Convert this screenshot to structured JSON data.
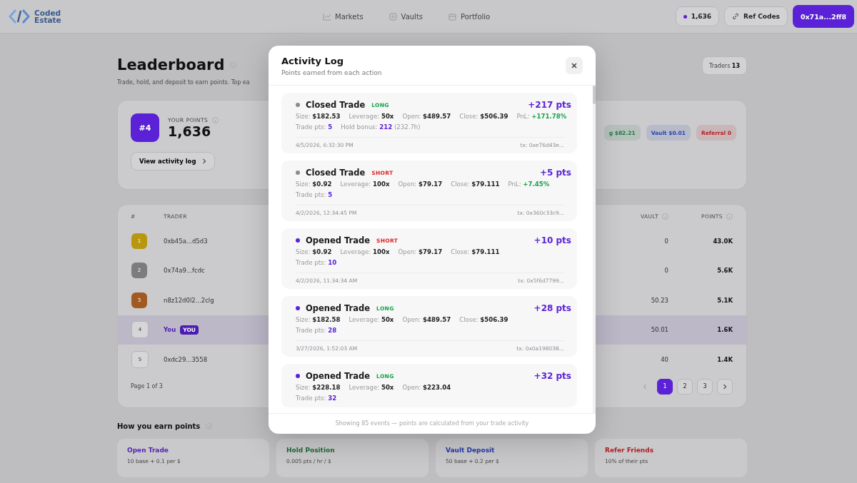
{
  "header": {
    "brand": [
      "Coded",
      "Estate"
    ],
    "nav": [
      {
        "label": "Markets"
      },
      {
        "label": "Vaults"
      },
      {
        "label": "Portfolio"
      }
    ],
    "points_pill": "1,636",
    "ref_button": "Ref Codes",
    "wallet_button": "0x71a...2ff8"
  },
  "leaderboard": {
    "title": "Leaderboard",
    "subtitle": "Trade, hold, and deposit to earn points. Top ea",
    "traders_label": "Traders",
    "traders_count": "13",
    "rank": "#4",
    "points_label": "YOUR POINTS",
    "points": "1,636",
    "activity_button": "View activity log",
    "badges": [
      {
        "text": "g $82.21",
        "color": "#1f7a40"
      },
      {
        "text": "Vault $0.01",
        "color": "#2a44b0"
      },
      {
        "text": "Referral 0",
        "color": "#b42323"
      }
    ],
    "columns": [
      "#",
      "TRADER",
      "VAULT",
      "POINTS"
    ],
    "rows": [
      {
        "rank": "1",
        "color": "#b8970f",
        "trader": "0xb45a...d5d3",
        "vault": "0",
        "points": "43.0K",
        "current": false
      },
      {
        "rank": "2",
        "color": "#7c7c7c",
        "trader": "0x74a9...fcdc",
        "vault": "0",
        "points": "5.6K",
        "current": false
      },
      {
        "rank": "3",
        "color": "#a15a22",
        "trader": "n8z12d0l2...2clg",
        "vault": "50.23",
        "points": "5.1K",
        "current": false
      },
      {
        "rank": "4",
        "trader": "You",
        "tag": "YOU",
        "vault": "50.01",
        "points": "1.6K",
        "current": true
      },
      {
        "rank": "5",
        "trader": "0xdc29...3558",
        "vault": "40",
        "points": "1.4K",
        "current": false
      }
    ],
    "page_info": "Page 1 of 3",
    "pages": [
      {
        "label": "1",
        "selected": true
      },
      {
        "label": "2",
        "selected": false
      },
      {
        "label": "3",
        "selected": false
      }
    ]
  },
  "earn": {
    "title": "How you earn points",
    "cards": [
      {
        "title": "Open Trade",
        "text": "10 base + 0.1 per $",
        "color": "#5524b0"
      },
      {
        "title": "Hold Position",
        "text": "0.005 pts / hr / $",
        "color": "#1d6a36"
      },
      {
        "title": "Vault Deposit",
        "text": "50 base + 0.2 per $",
        "color": "#2238a8"
      },
      {
        "title": "Refer Friends",
        "text": "10% of their pts",
        "color": "#b02020"
      }
    ]
  },
  "modal": {
    "title": "Activity Log",
    "subtitle": "Points earned from each action",
    "events": [
      {
        "kind": "closed",
        "title": "Closed Trade",
        "side": {
          "label": "LONG",
          "kind": "long"
        },
        "points": "+217 pts",
        "lines": [
          [
            {
              "label": "Size:",
              "value": "$182.53"
            },
            {
              "label": "Leverage:",
              "value": "50x"
            },
            {
              "label": "Open:",
              "value": "$489.57"
            },
            {
              "label": "Close:",
              "value": "$506.39"
            },
            {
              "label": "PnL:",
              "value": "+171.78%",
              "color": "#16a34a"
            }
          ],
          [
            {
              "label": "Trade pts:",
              "value": "5",
              "color": "#5b21d6"
            },
            {
              "label": "Hold bonus:",
              "value": "212",
              "color": "#5b21d6",
              "note": "(232.7h)"
            }
          ]
        ],
        "time": "4/5/2026, 6:32:30 PM",
        "tx": "tx: 0xe76d43e..."
      },
      {
        "kind": "closed",
        "title": "Closed Trade",
        "side": {
          "label": "SHORT",
          "kind": "short"
        },
        "points": "+5 pts",
        "lines": [
          [
            {
              "label": "Size:",
              "value": "$0.92"
            },
            {
              "label": "Leverage:",
              "value": "100x"
            },
            {
              "label": "Open:",
              "value": "$79.17"
            },
            {
              "label": "Close:",
              "value": "$79.111"
            },
            {
              "label": "PnL:",
              "value": "+7.45%",
              "color": "#16a34a"
            }
          ],
          [
            {
              "label": "Trade pts:",
              "value": "5",
              "color": "#5b21d6"
            }
          ]
        ],
        "time": "4/2/2026, 12:34:45 PM",
        "tx": "tx: 0x360c33c9..."
      },
      {
        "kind": "opened",
        "title": "Opened Trade",
        "side": {
          "label": "SHORT",
          "kind": "short"
        },
        "points": "+10 pts",
        "lines": [
          [
            {
              "label": "Size:",
              "value": "$0.92"
            },
            {
              "label": "Leverage:",
              "value": "100x"
            },
            {
              "label": "Open:",
              "value": "$79.17"
            },
            {
              "label": "Close:",
              "value": "$79.111"
            }
          ],
          [
            {
              "label": "Trade pts:",
              "value": "10",
              "color": "#5b21d6"
            }
          ]
        ],
        "time": "4/2/2026, 11:34:34 AM",
        "tx": "tx: 0x5f6d7799..."
      },
      {
        "kind": "opened",
        "title": "Opened Trade",
        "side": {
          "label": "LONG",
          "kind": "long"
        },
        "points": "+28 pts",
        "lines": [
          [
            {
              "label": "Size:",
              "value": "$182.58"
            },
            {
              "label": "Leverage:",
              "value": "50x"
            },
            {
              "label": "Open:",
              "value": "$489.57"
            },
            {
              "label": "Close:",
              "value": "$506.39"
            }
          ],
          [
            {
              "label": "Trade pts:",
              "value": "28",
              "color": "#5b21d6"
            }
          ]
        ],
        "time": "3/27/2026, 1:52:03 AM",
        "tx": "tx: 0x0a198038..."
      },
      {
        "kind": "opened",
        "title": "Opened Trade",
        "side": {
          "label": "LONG",
          "kind": "long"
        },
        "points": "+32 pts",
        "lines": [
          [
            {
              "label": "Size:",
              "value": "$228.18"
            },
            {
              "label": "Leverage:",
              "value": "50x"
            },
            {
              "label": "Open:",
              "value": "$223.04"
            }
          ],
          [
            {
              "label": "Trade pts:",
              "value": "32",
              "color": "#5b21d6"
            }
          ]
        ]
      }
    ],
    "footer": "Showing 85 events — points are calculated from your trade activity"
  }
}
